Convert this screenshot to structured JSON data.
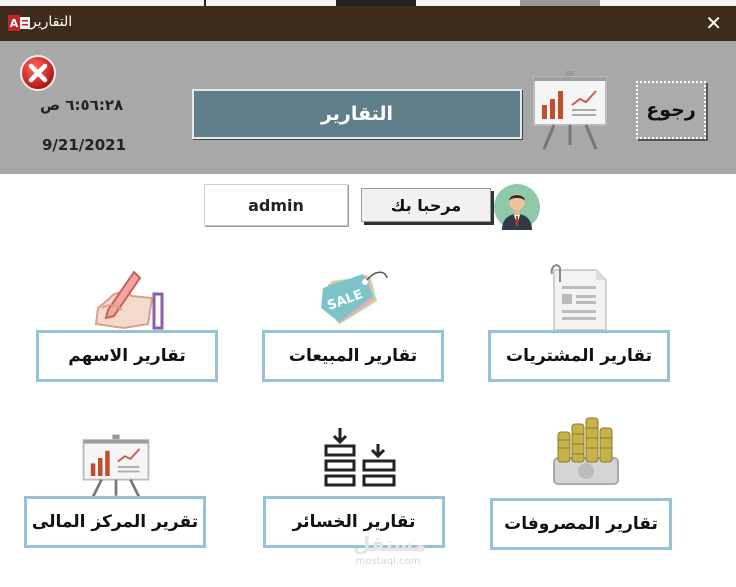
{
  "window": {
    "title": "التقارير",
    "close_glyph": "✕",
    "app_icon": "access-app-icon"
  },
  "header": {
    "exit_icon": "red-x-exit-icon",
    "time": "٦:٥٦:٢٨ ص",
    "date": "9/21/2021",
    "title": "التقارير",
    "chart_icon": "presentation-chart-icon",
    "back_label": "رجوع"
  },
  "user": {
    "username": "admin",
    "welcome": "مرحبا بك",
    "avatar_icon": "user-avatar-icon"
  },
  "reports": {
    "purchases": "تقارير المشتريات",
    "sales": "تقارير المبيعات",
    "shares": "تقارير الاسهم",
    "expenses": "تقارير المصروفات",
    "losses": "تقارير الخسائر",
    "financial": "تقرير المركز المالى"
  },
  "icons": {
    "purchases": "invoice-document-icon",
    "sales": "sale-tag-icon",
    "shares": "hand-writing-icon",
    "expenses": "coin-stacks-money-icon",
    "losses": "stacked-bars-arrows-icon",
    "financial": "presentation-chart-icon"
  },
  "watermark": {
    "logo": "مستقل",
    "url": "mostaql.com"
  },
  "colors": {
    "titlebar": "#3d2b1b",
    "header_bg": "#a8a8a8",
    "title_box": "#5f7f8b",
    "button_border": "#95c2d6"
  }
}
